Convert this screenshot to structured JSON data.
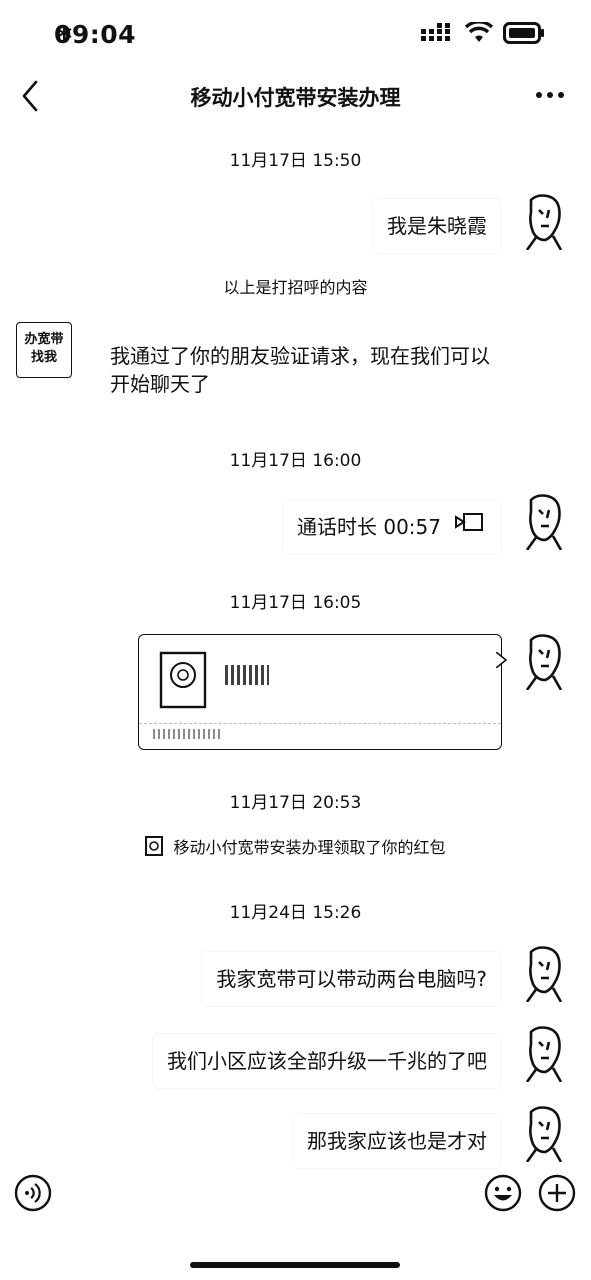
{
  "status": {
    "time": "09:04"
  },
  "nav": {
    "title": "移动小付宽带安装办理"
  },
  "messages": {
    "ts1": "11月17日 15:50",
    "me1": "我是朱晓霞",
    "sys_greet": "以上是打招呼的内容",
    "other_avatar_text": "办宽带\n找我",
    "other1": "我通过了你的朋友验证请求，现在我们可以开始聊天了",
    "ts2": "11月17日 16:00",
    "call": "通话时长 00:57",
    "ts3": "11月17日 16:05",
    "ts4": "11月17日 20:53",
    "sys_redpacket": "移动小付宽带安装办理领取了你的红包",
    "ts5": "11月24日 15:26",
    "me2": "我家宽带可以带动两台电脑吗?",
    "me3": "我们小区应该全部升级一千兆的了吧",
    "me4": "那我家应该也是才对"
  },
  "icons": {
    "back": "chevron-left-icon",
    "more": "more-icon",
    "voice": "voice-icon",
    "emoji": "emoji-icon",
    "plus": "plus-icon"
  },
  "colors": {
    "text": "#111111",
    "background": "#ffffff"
  }
}
